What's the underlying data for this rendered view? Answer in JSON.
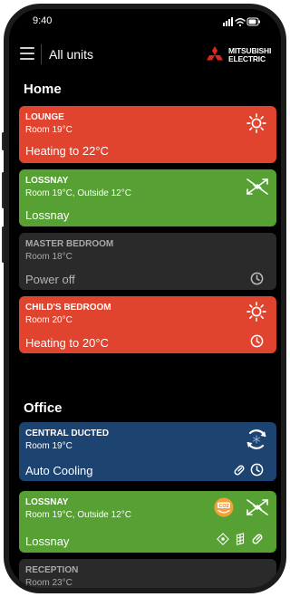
{
  "status_bar": {
    "time": "9:40"
  },
  "app_bar": {
    "title": "All units",
    "brand_line1": "MITSUBISHI",
    "brand_line2": "ELECTRIC"
  },
  "colors": {
    "heating": "#e0442f",
    "lossnay": "#56a034",
    "off": "#2a2a2a",
    "cooling": "#1d4370"
  },
  "groups": [
    {
      "title": "Home",
      "units": [
        {
          "name": "LOUNGE",
          "info": "Room 19°C",
          "mode": "Heating to 22°C",
          "state": "heating",
          "icons": [
            "sun-icon"
          ]
        },
        {
          "name": "LOSSNAY",
          "info": "Room 19°C, Outside 12°C",
          "mode": "Lossnay",
          "state": "lossnay",
          "icons": [
            "ventilation-icon"
          ]
        },
        {
          "name": "MASTER BEDROOM",
          "info": "Room 18°C",
          "mode": "Power off",
          "state": "off",
          "icons": [
            "clock-icon"
          ]
        },
        {
          "name": "CHILD'S BEDROOM",
          "info": "Room 20°C",
          "mode": "Heating to 20°C",
          "state": "heating",
          "icons": [
            "sun-icon",
            "clock-icon"
          ]
        }
      ]
    },
    {
      "title": "Office",
      "units": [
        {
          "name": "CENTRAL DUCTED",
          "info": "Room 19°C",
          "mode": "Auto Cooling",
          "state": "cooling",
          "icons": [
            "auto-cooling-icon",
            "link-icon",
            "clock-icon"
          ]
        },
        {
          "name": "LOSSNAY",
          "info": "Room 19°C, Outside 12°C",
          "mode": "Lossnay",
          "state": "lossnay",
          "icons": [
            "co2-badge-icon",
            "ventilation-icon",
            "sensor-icon",
            "filter-icon",
            "link-icon"
          ]
        },
        {
          "name": "RECEPTION",
          "info": "Room 23°C",
          "mode": "",
          "state": "off",
          "icons": []
        }
      ]
    }
  ]
}
